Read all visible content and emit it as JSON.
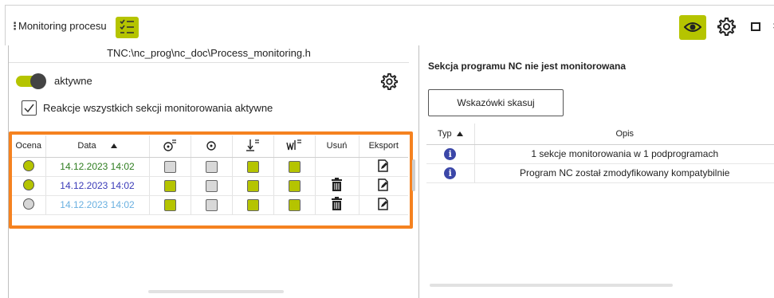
{
  "window": {
    "menu_icon": "vertical-dots-icon",
    "title": "Monitoring procesu",
    "list_icon": "checklist-icon",
    "eye_icon": "eye-icon",
    "settings_icon": "gear-icon",
    "maximize_icon": "maximize-icon",
    "close_glyph": "×"
  },
  "left": {
    "path": "TNC:\\nc_prog\\nc_doc\\Process_monitoring.h",
    "toggle_label": "aktywne",
    "toggle_on": true,
    "checkbox_label": "Reakcje wszystkich sekcji monitorowania aktywne",
    "checkbox_checked": true,
    "columns": [
      "Ocena",
      "Data",
      "",
      "",
      "",
      "",
      "Usuń",
      "Eksport"
    ],
    "column_icons": [
      "",
      "",
      "endpoint-tolerance-icon",
      "spindle-icon",
      "feed-limit-icon",
      "vibration-icon",
      "",
      ""
    ],
    "sort": "ascending",
    "rows": [
      {
        "rating": "green",
        "date": "14.12.2023 14:02",
        "date_color": "green",
        "c1": false,
        "c2": false,
        "c3": true,
        "c4": true,
        "deletable": false
      },
      {
        "rating": "green",
        "date": "14.12.2023 14:02",
        "date_color": "blue",
        "c1": true,
        "c2": false,
        "c3": true,
        "c4": true,
        "deletable": true
      },
      {
        "rating": "grey",
        "date": "14.12.2023 14:02",
        "date_color": "lightblue",
        "c1": true,
        "c2": false,
        "c3": true,
        "c4": true,
        "deletable": true
      }
    ]
  },
  "right": {
    "header": "Sekcja programu NC nie jest monitorowana",
    "clear_button": "Wskazówki skasuj",
    "columns": [
      "Typ",
      "Opis"
    ],
    "messages": [
      {
        "type": "info",
        "text": "1 sekcje monitorowania w 1 podprogramach"
      },
      {
        "type": "info",
        "text": "Program NC został zmodyfikowany kompatybilnie"
      }
    ]
  },
  "colors": {
    "accent": "#b5c400",
    "highlight": "#f58220",
    "info": "#3b47a8"
  }
}
